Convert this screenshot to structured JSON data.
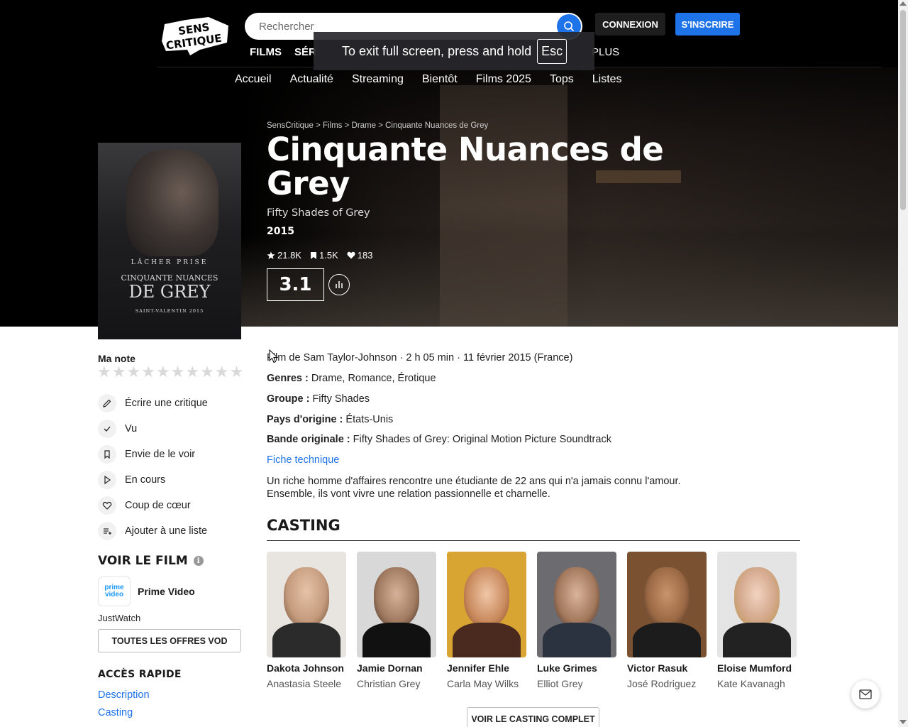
{
  "header": {
    "logo_text": "SENS CRITIQUE",
    "search_placeholder": "Rechercher",
    "login_label": "CONNEXION",
    "signup_label": "S'INSCRIRE",
    "categories": [
      "FILMS",
      "SÉR"
    ],
    "more_label": "PLUS",
    "fullscreen_notice": "To exit full screen, press and hold",
    "fullscreen_key": "Esc"
  },
  "subnav": [
    "Accueil",
    "Actualité",
    "Streaming",
    "Bientôt",
    "Films 2025",
    "Tops",
    "Listes"
  ],
  "movie": {
    "breadcrumb": "SensCritique > Films > Drame > Cinquante Nuances de Grey",
    "title": "Cinquante Nuances de Grey",
    "original_title": "Fifty Shades of Grey",
    "year": "2015",
    "ratings_count": "21.8K",
    "wishlist_count": "1.5K",
    "favorites_count": "183",
    "score": "3.1",
    "poster": {
      "tagline": "LÂCHER PRISE",
      "title_line1": "CINQUANTE NUANCES",
      "title_line2": "DE GREY",
      "release": "SAINT-VALENTIN 2015"
    },
    "meta_line": "Film de Sam Taylor-Johnson · 2 h 05 min · 11 février 2015 (France)",
    "genres_label": "Genres :",
    "genres_value": "Drame, Romance, Érotique",
    "groupe_label": "Groupe :",
    "groupe_value": "Fifty Shades",
    "pays_label": "Pays d'origine :",
    "pays_value": "États-Unis",
    "bande_label": "Bande originale :",
    "bande_value": "Fifty Shades of Grey: Original Motion Picture Soundtrack",
    "fiche_link": "Fiche technique",
    "synopsis": "Un riche homme d'affaires rencontre une étudiante de 22 ans qui n'a jamais connu l'amour. Ensemble, ils vont vivre une relation passionnelle et charnelle."
  },
  "sidebar": {
    "ma_note": "Ma note",
    "actions": [
      "Écrire une critique",
      "Vu",
      "Envie de le voir",
      "En cours",
      "Coup de cœur",
      "Ajouter à une liste"
    ],
    "voir_title": "VOIR LE FILM",
    "provider_logo_line1": "prime",
    "provider_logo_line2": "video",
    "provider_name": "Prime Video",
    "justwatch": "JustWatch",
    "vod_button": "TOUTES LES OFFRES VOD",
    "acces_title": "ACCÈS RAPIDE",
    "acces_links": [
      "Description",
      "Casting"
    ]
  },
  "casting": {
    "title": "CASTING",
    "full_cast_button": "VOIR LE CASTING COMPLET",
    "actors": [
      {
        "name": "Dakota Johnson",
        "role": "Anastasia Steele"
      },
      {
        "name": "Jamie Dornan",
        "role": "Christian Grey"
      },
      {
        "name": "Jennifer Ehle",
        "role": "Carla May Wilks"
      },
      {
        "name": "Luke Grimes",
        "role": "Elliot Grey"
      },
      {
        "name": "Victor Rasuk",
        "role": "José Rodriguez"
      },
      {
        "name": "Eloise Mumford",
        "role": "Kate Kavanagh"
      }
    ]
  },
  "colors": {
    "accent": "#1e73e8",
    "header_bg": "#000000"
  }
}
